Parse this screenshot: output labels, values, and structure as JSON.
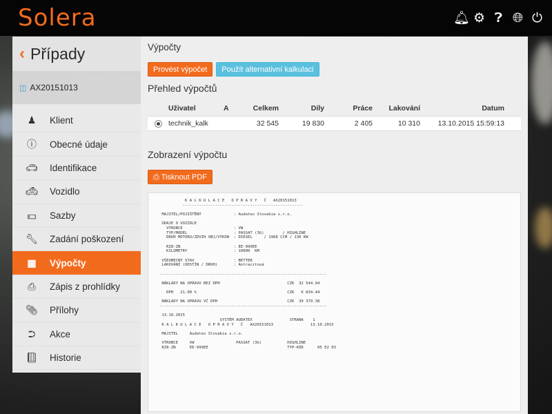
{
  "brand": {
    "logo_text": "Solera",
    "accent": "#f26b1d"
  },
  "header_icons": [
    "bell-icon",
    "gear-icon",
    "help-icon",
    "globe-icon",
    "power-icon"
  ],
  "sidebar": {
    "title": "Případy",
    "case_id": "AX20151013",
    "items": [
      {
        "label": "Klient",
        "icon": "user-icon"
      },
      {
        "label": "Obecné údaje",
        "icon": "info-icon"
      },
      {
        "label": "Identifikace",
        "icon": "car-icon"
      },
      {
        "label": "Vozidlo",
        "icon": "taxi-icon"
      },
      {
        "label": "Sazby",
        "icon": "money-icon"
      },
      {
        "label": "Zadání poškození",
        "icon": "wrench-icon"
      },
      {
        "label": "Výpočty",
        "icon": "calculator-icon",
        "active": true
      },
      {
        "label": "Zápis z prohlídky",
        "icon": "print-icon"
      },
      {
        "label": "Přílohy",
        "icon": "paperclip-icon"
      },
      {
        "label": "Akce",
        "icon": "share-icon"
      },
      {
        "label": "Historie",
        "icon": "book-icon"
      }
    ]
  },
  "main": {
    "section_title": "Výpočty",
    "btn_calculate": "Provést výpočet",
    "btn_alternative": "Použít alternativní kalkulaci",
    "overview_title": "Přehled výpočtů",
    "table": {
      "headers": [
        "Uživatel",
        "A",
        "Celkem",
        "Díly",
        "Práce",
        "Lakování",
        "Datum"
      ],
      "rows": [
        [
          "technik_kalk",
          "",
          "32 545",
          "19 830",
          "2 405",
          "10 310",
          "13.10.2015 15:59:13"
        ]
      ]
    },
    "display_title": "Zobrazení výpočtu",
    "btn_print": "Tisknout PDF",
    "document_text": "           K A L K U L A C E   O P R A V Y   Č   AX20151013\n          ----------------------------------------------------\n\n MAJITEL/POJIŠTĚNÝ              : Audatex Slovakia s.r.o.\n\n ÚDAJE O VOZIDLE\n   VÝROBCE                      : VW\n   TYP/MODEL                    : PASSAT (3G)        / HIGHLINE\n   DRUH MOTORU/ZDVIH OBJ/VÝKON  : DIESEL     / 1968 CCM / 130 KW\n\n   RZ8-ZN                       : EE-999EE\n   KILOMETRY                    : 10000  KM\n\n VŠEOBECNÝ STAV                 : BETTER\n LAKOVÁNÍ (ODSTÍN / DRUH)       : Antracitová\n\n------------------------------------------------------------------------\n\n NÁKLADY NA OPRAVU BEZ DPH                             CZK  32 544.94\n\n   DPH   21.00 %                                       CZK   6 834.44\n\n NÁKLADY NA OPRAVU VČ DPH                              CZK  39 379.38\n------------------------------------------------------------------------\n\n 13.10.2015\n                          SYSTÉM AUDATEX                STRANA    1\n K A L K U L A C E   O P R A V Y   Č   AX20151013                13.10.2015\n\n MAJITEL     Audatex Slovakia s.r.o.\n\n VÝROBCE     VW                  PASSAT (3G)           HIGHLINE\n RZ8-ZN      EE-999EE                                  TYP-KÓD      05 E2 03"
  }
}
